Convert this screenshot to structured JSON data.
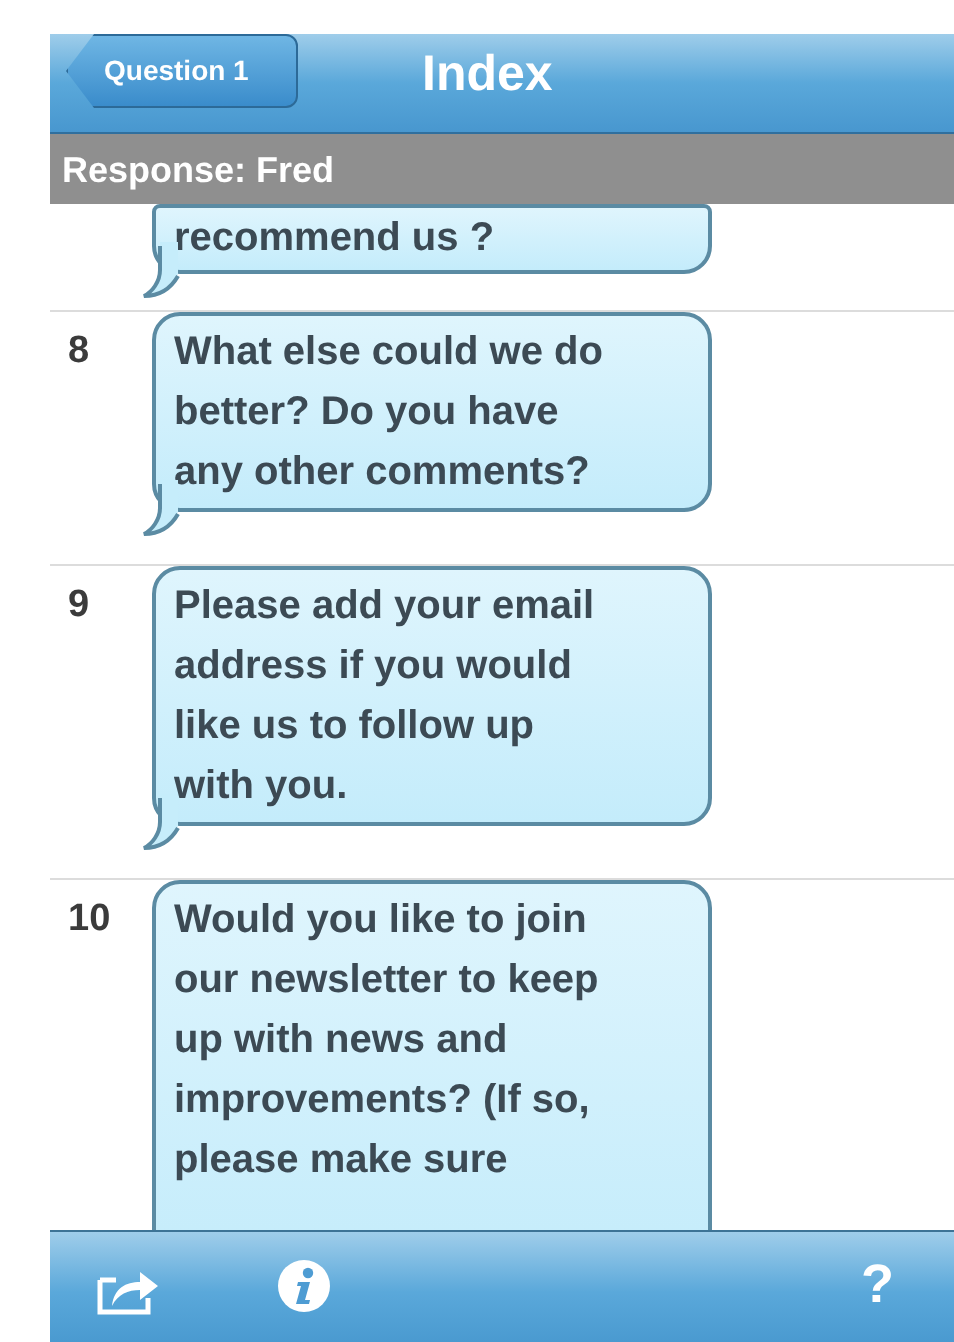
{
  "nav_bar": {
    "back_button": "Question 1",
    "title": "Index"
  },
  "response_bar": {
    "label": "Response: Fred"
  },
  "questions": [
    {
      "lines": [
        "recommend us ?"
      ]
    },
    {
      "number": "8",
      "lines": [
        "What else could we do",
        "better? Do you have",
        "any other comments?"
      ]
    },
    {
      "number": "9",
      "lines": [
        "Please add your email",
        "address if you would",
        "like us to follow up",
        "with you."
      ]
    },
    {
      "number": "10",
      "lines": [
        "Would you like to join",
        "our newsletter to keep",
        "up with news and",
        "improvements? (If so,",
        "please make sure"
      ]
    }
  ],
  "toolbar": {
    "help": "?"
  }
}
